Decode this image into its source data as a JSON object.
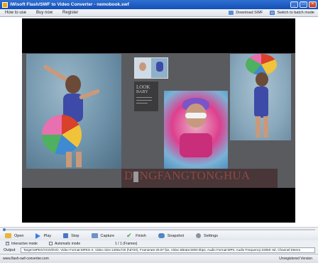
{
  "window": {
    "title": "iWisoft Flash/SWF to Video Converter - nemobook.swf"
  },
  "menu": {
    "items": [
      "How to use",
      "Buy now",
      "Register"
    ],
    "download_label": "Download SWF",
    "switch_label": "Switch to batch mode"
  },
  "preview": {
    "look_title": "LOOK",
    "look_subtitle": "BABY",
    "brand_left": "D",
    "brand_right": "NGFANGTONGHUA"
  },
  "toolbar": {
    "open": "Open",
    "play": "Play",
    "stop": "Stop",
    "capture": "Capture",
    "finish": "Finish",
    "snapshot": "Snapshot",
    "settings": "Settings"
  },
  "options": {
    "interactive_mode": "Interactive mode",
    "interactive_checked": true,
    "automatic_mode": "Automatic mode",
    "automatic_checked": false,
    "frames": "1 / 1 (Frames)"
  },
  "output": {
    "label": "Output",
    "value": "Target:MPEG/VCD/DVD, Video Format:MPEG-2, Video Size:1280x720 (hd720), Framerate:29.97 fps, Video Bitrate:5000 kbps, Audio Format:MP2, Audio Frequency:22050 HZ, Channel:Stereo"
  },
  "status": {
    "url": "www.flash-swf-converter.com",
    "version": "Unregistered Version"
  }
}
